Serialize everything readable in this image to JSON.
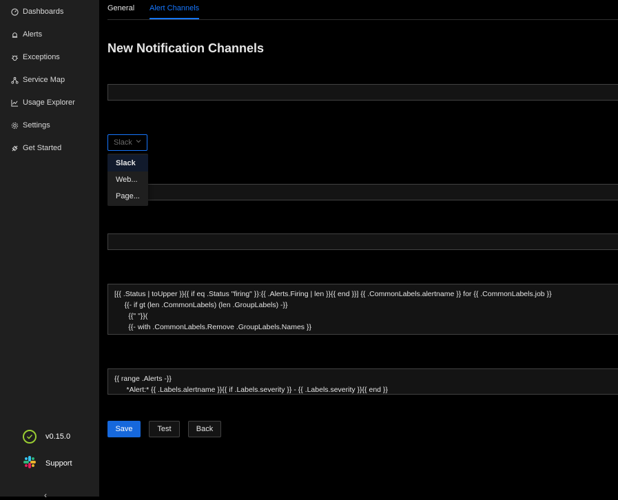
{
  "sidebar": {
    "items": [
      {
        "label": "Dashboards",
        "icon": "dashboard-icon"
      },
      {
        "label": "Alerts",
        "icon": "alert-icon"
      },
      {
        "label": "Exceptions",
        "icon": "bug-icon"
      },
      {
        "label": "Service Map",
        "icon": "deployment-icon"
      },
      {
        "label": "Usage Explorer",
        "icon": "line-chart-icon"
      },
      {
        "label": "Settings",
        "icon": "gear-icon"
      },
      {
        "label": "Get Started",
        "icon": "api-icon"
      }
    ],
    "version": "v0.15.0",
    "support": "Support"
  },
  "tabs": [
    {
      "label": "General",
      "active": false
    },
    {
      "label": "Alert Channels",
      "active": true
    }
  ],
  "page": {
    "title": "New Notification Channels",
    "name_value": "",
    "type_selected": "Slack",
    "type_options": [
      "Slack",
      "Web...",
      "Page..."
    ],
    "webhook_value": "",
    "recipient_value": "",
    "title_template": "[{{ .Status | toUpper }}{{ if eq .Status \"firing\" }}:{{ .Alerts.Firing | len }}{{ end }}] {{ .CommonLabels.alertname }} for {{ .CommonLabels.job }}\n     {{- if gt (len .CommonLabels) (len .GroupLabels) -}}\n       {{\" \"}}(\n       {{- with .CommonLabels.Remove .GroupLabels.Names }}",
    "description_template": "{{ range .Alerts -}}\n      *Alert:* {{ .Labels.alertname }}{{ if .Labels.severity }} - {{ .Labels.severity }}{{ end }}"
  },
  "buttons": {
    "save": "Save",
    "test": "Test",
    "back": "Back"
  },
  "colors": {
    "accent": "#1677ff",
    "version_ok": "#9acd32"
  }
}
